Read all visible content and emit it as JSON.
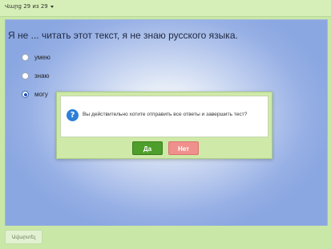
{
  "header": {
    "counter_label": "Վարց 29 из 29"
  },
  "question": {
    "text": "Я не ... читать этот текст, я не знаю русского языка.",
    "options": [
      {
        "label": "умею",
        "selected": false
      },
      {
        "label": "знаю",
        "selected": false
      },
      {
        "label": "могу",
        "selected": true
      }
    ]
  },
  "dialog": {
    "icon": "question-icon",
    "message": "Вы действительно хотите отправить все ответы и завершить тест?",
    "yes_label": "Да",
    "no_label": "Нет"
  },
  "footer": {
    "finish_label": "Ավարտել"
  },
  "colors": {
    "yes_button": "#4d9e2a",
    "no_button": "#f0908c",
    "info_icon": "#2d7fd6",
    "frame": "#c9e7a6"
  }
}
